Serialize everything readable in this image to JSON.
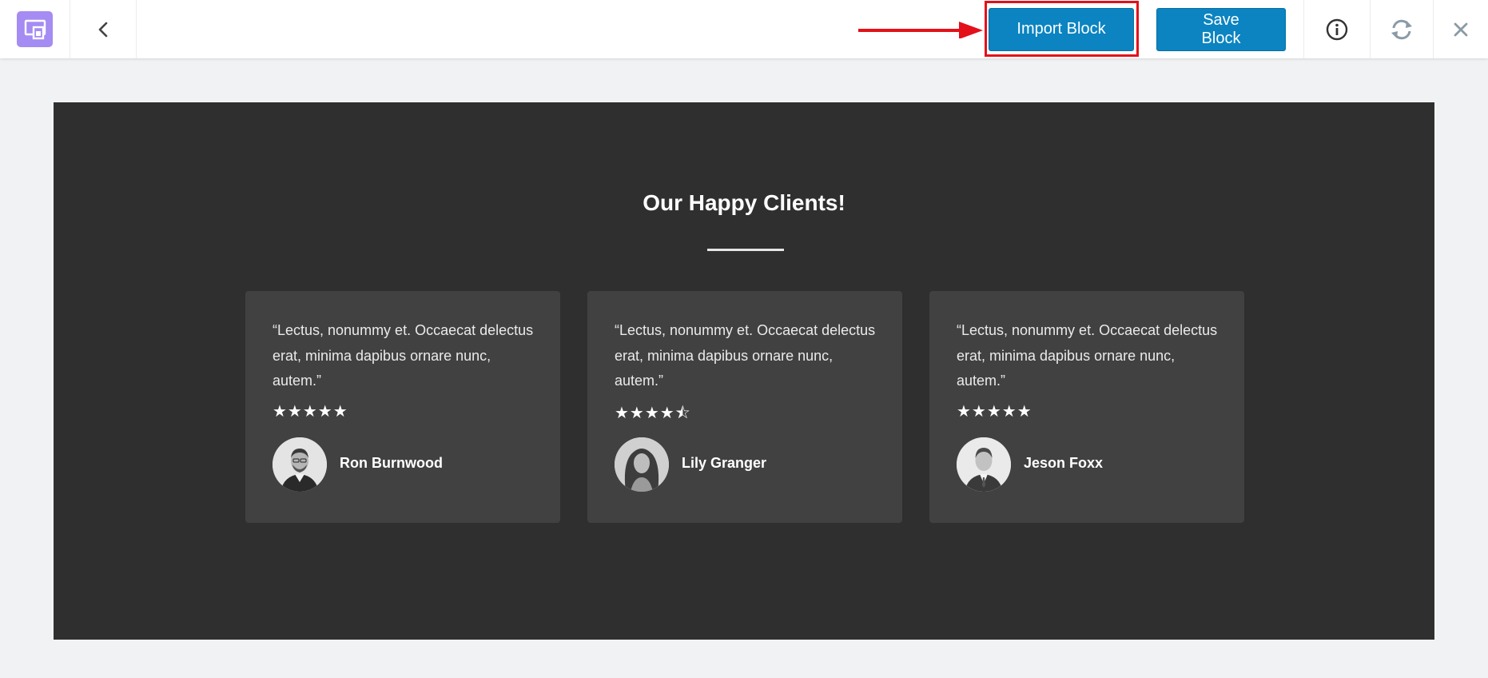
{
  "toolbar": {
    "import_label": "Import Block",
    "save_label": "Save Block",
    "accent_color": "#0b84c1",
    "highlight_color": "#e3101a",
    "logo_color": "#a48cf3"
  },
  "section": {
    "title": "Our Happy Clients!"
  },
  "testimonials": [
    {
      "quote": "“Lectus, nonummy et. Occaecat delectus erat, minima dapibus ornare nunc, autem.”",
      "stars": "★★★★★",
      "rating": 5,
      "name": "Ron Burnwood"
    },
    {
      "quote": "“Lectus, nonummy et. Occaecat delectus erat, minima dapibus ornare nunc, autem.”",
      "stars": "★★★★⯪",
      "rating": 4.5,
      "name": "Lily Granger"
    },
    {
      "quote": "“Lectus, nonummy et. Occaecat delectus erat, minima dapibus ornare nunc, autem.”",
      "stars": "★★★★★",
      "rating": 5,
      "name": "Jeson Foxx"
    }
  ]
}
